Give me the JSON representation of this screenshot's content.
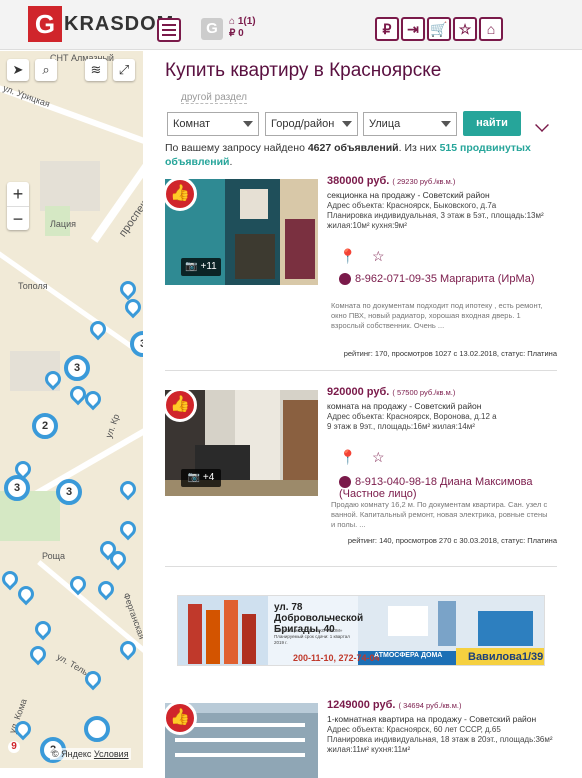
{
  "header": {
    "logo_letter": "G",
    "logo_text": "KRASDOM",
    "small_logo": "G",
    "home_count": "1(1)",
    "ruble_count": "0",
    "buttons": [
      "ruble-icon",
      "door-icon",
      "cart-icon",
      "star-icon",
      "home-icon"
    ],
    "ruble_symbol": "₽"
  },
  "map": {
    "labels": [
      "СНТ Алмазный",
      "ул. Урицкая",
      "Лация",
      "Тополя",
      "Роща",
      "Ферганская",
      "ул. Тельм",
      "ул. Кома",
      "проспект",
      "ул. Кр"
    ],
    "clusters": [
      "3",
      "2",
      "3",
      "3",
      "2"
    ],
    "copyright": "© Яндекс",
    "terms": "Условия"
  },
  "page": {
    "title": "Купить квартиру в Красноярске",
    "other_section": "другой раздел"
  },
  "filters": {
    "type": "Комнат",
    "city": "Город/район",
    "street": "Улица",
    "find_button": "найти"
  },
  "found": {
    "prefix": "По вашему запросу найдено ",
    "count": "4627 объявлений",
    "middle": ". Из них ",
    "premium": "515 продвинутых объявлений",
    "suffix": "."
  },
  "listings": [
    {
      "price": "380000 руб.",
      "price_per_m": "( 29230 руб./кв.м.)",
      "title": "секционка на продажу - Советский район",
      "address": "Адрес объекта: Красноярск, Быковского, д.7а",
      "layout": "Планировка индивидуальная, 3 этаж в 5эт., площадь:13м² жилая:10м² кухня:9м²",
      "photos": "+11",
      "phone": "8-962-071-09-35 Маргарита (ИрМа)",
      "description": "Комната по документам подходит под ипотеку , есть ремонт, окно ПВХ, новый радиатор, хорошая входная дверь. 1 взрослый собственник. Очень ...",
      "meta": "рейтинг: 170, просмотров 1027 с 13.02.2018, статус: Платина"
    },
    {
      "price": "920000 руб.",
      "price_per_m": "( 57500 руб./кв.м.)",
      "title": "комната на продажу - Советский район",
      "address": "Адрес объекта: Красноярск, Воронова, д.12 а",
      "layout": "9 этаж в 9эт., площадь:16м² жилая:14м²",
      "photos": "+4",
      "phone": "8-913-040-98-18 Диана Максимова (Частное лицо)",
      "description": "Продаю комнату 16,2 м. По документам квартира. Сан. узел с ванной. Капитальный ремонт, новая электрика, ровные стены и полы. ...",
      "meta": "рейтинг: 140, просмотров 270 с 30.03.2018, статус: Платина"
    },
    {
      "price": "1249000 руб.",
      "price_per_m": "( 34694 руб./кв.м.)",
      "title": "1-комнатная квартира на продажу - Советский район",
      "address": "Адрес объекта: Красноярск, 60 лет СССР, д.65",
      "layout": "Планировка индивидуальная, 18 этаж в 20эт., площадь:36м² жилая:11м² кухня:11м²"
    }
  ],
  "banner": {
    "address": "ул. 78 Добровольческой Бригады, 40",
    "developer": "Застройщик: ООО «ЭКО ПРОМ» Планируемый срок сдачи: 1 квартал 2019 г.",
    "phone": "200-11-10, 272-74-04",
    "brand": "АТМОСФЕРА ДОМА",
    "street": "Вавилова1/39"
  },
  "colors": {
    "accent": "#7a1a4a",
    "teal": "#26a59a",
    "red": "#d0252b",
    "pin": "#3a9ad9"
  }
}
